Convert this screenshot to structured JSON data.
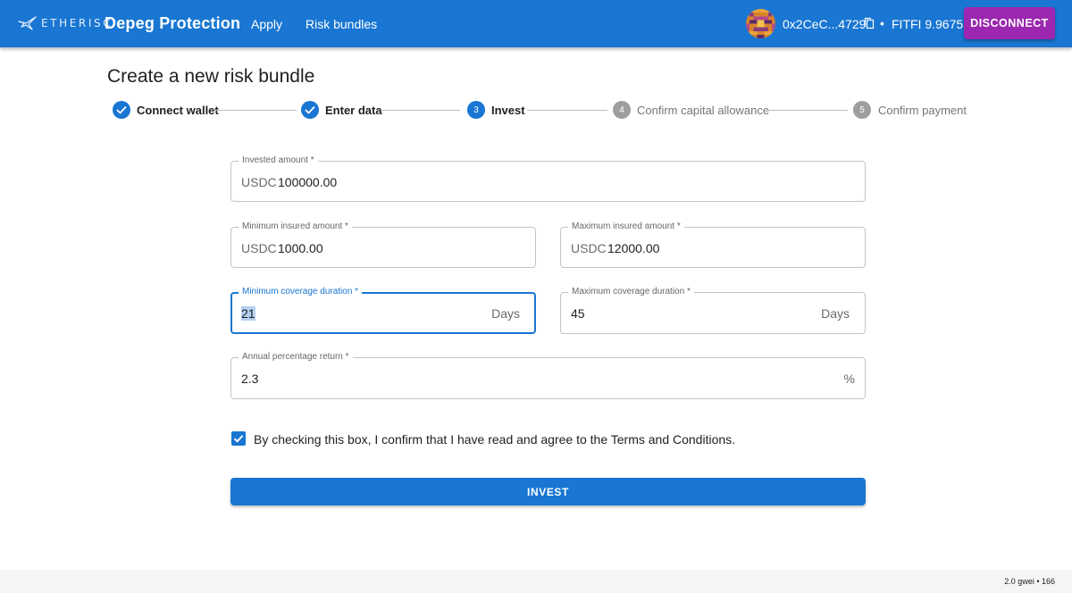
{
  "header": {
    "logo_text": "ETHERISC",
    "app_title": "Depeg Protection",
    "nav": [
      {
        "label": "Apply"
      },
      {
        "label": "Risk bundles"
      }
    ],
    "wallet_address": "0x2CeC...4729",
    "separator": "•",
    "balance": "FITFI 9.9675",
    "disconnect_label": "DISCONNECT"
  },
  "page": {
    "title": "Create a new risk bundle"
  },
  "stepper": {
    "steps": [
      {
        "number": "1",
        "label": "Connect wallet",
        "status": "completed"
      },
      {
        "number": "2",
        "label": "Enter data",
        "status": "completed"
      },
      {
        "number": "3",
        "label": "Invest",
        "status": "active"
      },
      {
        "number": "4",
        "label": "Confirm capital allowance",
        "status": "pending"
      },
      {
        "number": "5",
        "label": "Confirm payment",
        "status": "pending"
      }
    ]
  },
  "form": {
    "invested_amount": {
      "label": "Invested amount *",
      "prefix": "USDC",
      "value": "100000.00"
    },
    "min_insured": {
      "label": "Minimum insured amount *",
      "prefix": "USDC",
      "value": "1000.00"
    },
    "max_insured": {
      "label": "Maximum insured amount *",
      "prefix": "USDC",
      "value": "12000.00"
    },
    "min_duration": {
      "label": "Minimum coverage duration *",
      "value": "21",
      "suffix": "Days"
    },
    "max_duration": {
      "label": "Maximum coverage duration *",
      "value": "45",
      "suffix": "Days"
    },
    "apr": {
      "label": "Annual percentage return *",
      "value": "2.3",
      "suffix": "%"
    },
    "terms_label": "By checking this box, I confirm that I have read and agree to the Terms and Conditions.",
    "terms_checked": true,
    "invest_label": "INVEST"
  },
  "footer": {
    "text": "2.0 gwei • 166"
  },
  "colors": {
    "primary": "#1976d2",
    "secondary": "#9c27b0",
    "pending_step": "#9e9e9e"
  }
}
